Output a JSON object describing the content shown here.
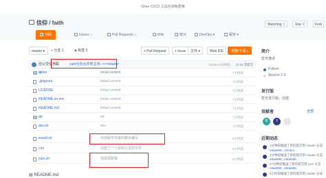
{
  "banner": {
    "text": "Gitee CI/CD 工具内测免费用"
  },
  "repo": {
    "title": "信仰 / faith"
  },
  "header_buttons": {
    "watching": {
      "label": "Watching",
      "count": "1"
    },
    "star": {
      "label": "Star",
      "count": "0"
    },
    "fork": {
      "label": "Fork",
      "count": "0"
    }
  },
  "tabs": [
    {
      "label": "代码"
    },
    {
      "label": "Issues",
      "count": "0"
    },
    {
      "label": "Pull Requests",
      "count": "0"
    },
    {
      "label": "Wiki"
    },
    {
      "label": "统计"
    },
    {
      "label": "DevOps"
    },
    {
      "label": "服务"
    }
  ],
  "toolbar": {
    "branch": "master",
    "branches": "分支 1",
    "tags": "标签 0",
    "pull_request": "+ Pull Request",
    "issue": "+ Issue",
    "file": "文件",
    "web_ide": "Web IDE",
    "clone": "克隆/下载"
  },
  "commit": {
    "user": "俭公交信用联",
    "message": "yum分支合并到主线-->>>master",
    "hash": "13c6e4",
    "time": "6分钟前",
    "count": "10 次提交"
  },
  "files": [
    {
      "name": "d",
      "msg": "Initial commit",
      "date": "",
      "type": "dir"
    },
    {
      "name": ".gitee",
      "msg": "Initial commit",
      "date": "7小时前",
      "type": "dir"
    },
    {
      "name": ".gitignore",
      "msg": "Initial commit",
      "date": "7小时前",
      "type": "file"
    },
    {
      "name": "LICENSE",
      "msg": "Initial commit",
      "date": "7小时前",
      "type": "file"
    },
    {
      "name": "README.en.md",
      "msg": "Initial commit",
      "date": "7小时前",
      "type": "file"
    },
    {
      "name": "README.md",
      "msg": "Initial commit",
      "date": "7小时前",
      "type": "file"
    },
    {
      "name": "dd",
      "msg": "dd",
      "date": "7小时前",
      "type": "dir"
    },
    {
      "name": "dev.txt",
      "msg": "dev",
      "date": "7小时前",
      "type": "file"
    },
    {
      "name": "install.sh",
      "msg": "完成服务安装的脚本编写",
      "date": "6小时前",
      "type": "file"
    },
    {
      "name": "t.txt",
      "msg": "创建了一个新的分支的文件",
      "date": "6小时前",
      "type": "file"
    },
    {
      "name": "yum.sh",
      "msg": "完成源配置",
      "date": "6小时前",
      "type": "file"
    }
  ],
  "readme": {
    "title": "README.md"
  },
  "sidebar": {
    "intro_title": "简介",
    "intro_text": "暂无描述",
    "lang": "Python",
    "license": "Apache-2.0",
    "release_title": "发行版",
    "release_text": "暂无发行版，创建",
    "contrib_title": "贡献者",
    "contrib_count": "全部",
    "contributors": [
      "冬",
      "Y",
      ""
    ],
    "activity_title": "近期动态",
    "activities": [
      {
        "text": "1分钟前推送了新的提交到 master 分支",
        "sub": "e8aa596...13c6e4"
      },
      {
        "text": "2分钟前推送了新的提交到 master 分支",
        "sub": "e8aa596...e8aa596"
      },
      {
        "text": "27分钟前推送了新的提交到 yum 分支",
        "sub": "e8aa596...e8aa596"
      },
      {
        "text": "6小时前推送了新的提交到 master 分支",
        "sub": ""
      }
    ]
  },
  "colors": {
    "accent": "#fe7300",
    "link": "#2b6cd6",
    "highlight": "#e0212a"
  }
}
